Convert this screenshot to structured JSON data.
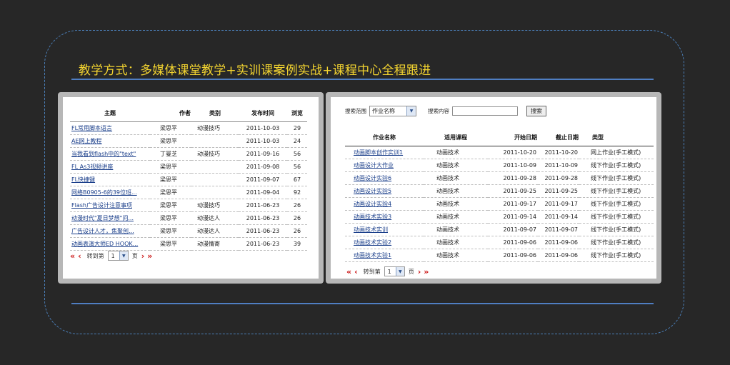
{
  "heading": "教学方式：多媒体课堂教学+实训课案例实战+课程中心全程跟进",
  "colors": {
    "heading": "#f2d330",
    "rule": "#4f7ec2",
    "link": "#1a3e8a",
    "pager_arrow": "#cc1b1b"
  },
  "left_table": {
    "headers": [
      "主题",
      "作者",
      "类别",
      "发布时间",
      "浏览"
    ],
    "rows": [
      [
        "FL常用脚本语言",
        "梁思平",
        "动漫技巧",
        "2011-10-03",
        "29"
      ],
      [
        "AE网上教程",
        "梁思平",
        "",
        "2011-10-03",
        "24"
      ],
      [
        "当我看到flash中的\"text\"",
        "丁曼芝",
        "动漫技巧",
        "2011-09-16",
        "56"
      ],
      [
        "FL As3视频讲座",
        "梁思平",
        "",
        "2011-09-08",
        "56"
      ],
      [
        "FL快捷键",
        "梁思平",
        "",
        "2011-09-07",
        "67"
      ],
      [
        "网络B0905-6的39位班...",
        "梁思平",
        "",
        "2011-09-04",
        "92"
      ],
      [
        "Flash广告设计注意事项",
        "梁思平",
        "动漫技巧",
        "2011-06-23",
        "26"
      ],
      [
        "动漫时代\"夏日梦想\"问...",
        "梁思平",
        "动漫达人",
        "2011-06-23",
        "26"
      ],
      [
        "广告设计人才，焦聚创...",
        "梁思平",
        "动漫达人",
        "2011-06-23",
        "26"
      ],
      [
        "动画表演大师ED HOOK...",
        "梁思平",
        "动漫情寄",
        "2011-06-23",
        "39"
      ]
    ],
    "pager": {
      "first": "«",
      "prev": "‹",
      "goto_label": "转到第",
      "page_value": "1",
      "page_suffix": "页",
      "next": "›",
      "last": "»"
    }
  },
  "right_panel": {
    "search": {
      "scope_label": "搜索范围",
      "scope_value": "作业名称",
      "content_label": "搜索内容",
      "content_value": "",
      "button": "搜索"
    },
    "headers": [
      "作业名称",
      "适用课程",
      "开始日期",
      "截止日期",
      "类型"
    ],
    "rows": [
      [
        "动画脚本创作实训1",
        "动画技术",
        "2011-10-20",
        "2011-10-20",
        "网上作业(手工模式)"
      ],
      [
        "动画设计大作业",
        "动画技术",
        "2011-10-09",
        "2011-10-09",
        "线下作业(手工模式)"
      ],
      [
        "动画设计实验6",
        "动画技术",
        "2011-09-28",
        "2011-09-28",
        "线下作业(手工模式)"
      ],
      [
        "动画设计实验5",
        "动画技术",
        "2011-09-25",
        "2011-09-25",
        "线下作业(手工模式)"
      ],
      [
        "动画设计实验4",
        "动画技术",
        "2011-09-17",
        "2011-09-17",
        "线下作业(手工模式)"
      ],
      [
        "动画技术实验3",
        "动画技术",
        "2011-09-14",
        "2011-09-14",
        "线下作业(手工模式)"
      ],
      [
        "动画技术实训",
        "动画技术",
        "2011-09-07",
        "2011-09-07",
        "线下作业(手工模式)"
      ],
      [
        "动画技术实验2",
        "动画技术",
        "2011-09-06",
        "2011-09-06",
        "线下作业(手工模式)"
      ],
      [
        "动画技术实验1",
        "动画技术",
        "2011-09-06",
        "2011-09-06",
        "线下作业(手工模式)"
      ]
    ],
    "pager": {
      "first": "«",
      "prev": "‹",
      "goto_label": "转到第",
      "page_value": "1",
      "page_suffix": "页",
      "next": "›",
      "last": "»"
    }
  }
}
